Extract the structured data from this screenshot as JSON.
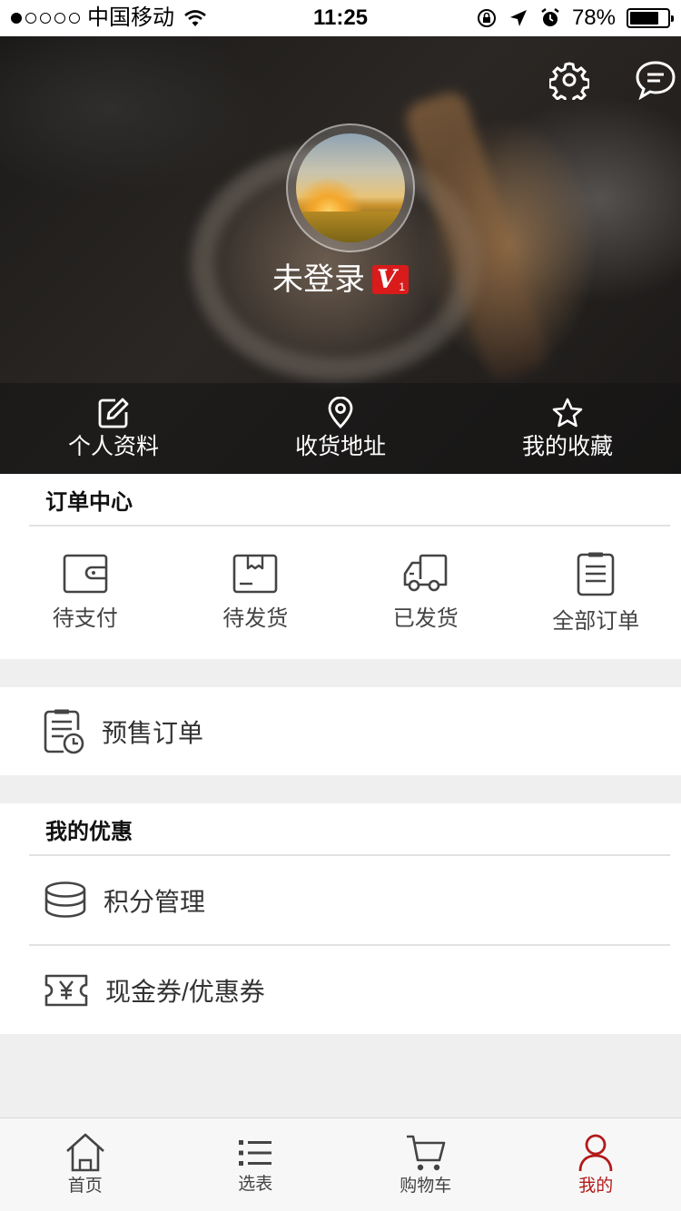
{
  "status_bar": {
    "carrier": "中国移动",
    "time": "11:25",
    "battery_percent": "78%",
    "battery_level": 0.78,
    "signal_bars_filled": 1,
    "signal_bars_total": 5
  },
  "header": {
    "settings_icon": "gear-icon",
    "message_icon": "message-icon",
    "username": "未登录",
    "vip_letter": "V",
    "vip_level": "1",
    "actions": [
      {
        "label": "个人资料",
        "icon": "edit-icon"
      },
      {
        "label": "收货地址",
        "icon": "location-pin-icon"
      },
      {
        "label": "我的收藏",
        "icon": "star-icon"
      }
    ]
  },
  "order_center": {
    "title": "订单中心",
    "items": [
      {
        "label": "待支付",
        "icon": "wallet-icon"
      },
      {
        "label": "待发货",
        "icon": "package-box-icon"
      },
      {
        "label": "已发货",
        "icon": "delivery-truck-icon"
      },
      {
        "label": "全部订单",
        "icon": "clipboard-list-icon"
      }
    ]
  },
  "presale": {
    "label": "预售订单",
    "icon": "clipboard-clock-icon"
  },
  "discounts": {
    "title": "我的优惠",
    "items": [
      {
        "label": "积分管理",
        "icon": "coin-stack-icon"
      },
      {
        "label": "现金券/优惠券",
        "icon": "yuan-ticket-icon"
      }
    ]
  },
  "tab_bar": {
    "tabs": [
      {
        "label": "首页",
        "icon": "home-icon",
        "active": false
      },
      {
        "label": "选表",
        "icon": "list-icon",
        "active": false
      },
      {
        "label": "购物车",
        "icon": "cart-icon",
        "active": false
      },
      {
        "label": "我的",
        "icon": "user-icon",
        "active": true
      }
    ],
    "active_color": "#b21a1a"
  },
  "colors": {
    "accent": "#b21a1a",
    "vip_badge": "#d91b1b",
    "page_background": "#efefef"
  }
}
